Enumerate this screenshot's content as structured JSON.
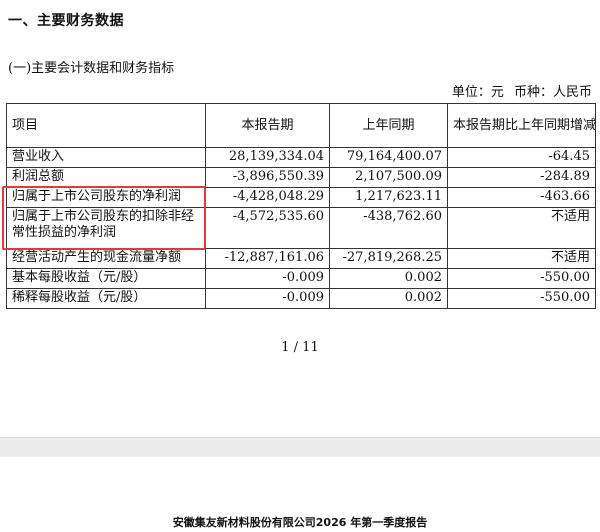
{
  "section_title": "一、主要财务数据",
  "subsection_title": "(一)主要会计数据和财务指标",
  "unit_line": {
    "unit": "单位：元",
    "currency": "币种：人民币"
  },
  "table": {
    "headers": [
      "项目",
      "本报告期",
      "上年同期",
      "本报告期比上年同期增减变动幅度(%)"
    ],
    "rows": [
      [
        "营业收入",
        "28,139,334.04",
        "79,164,400.07",
        "-64.45"
      ],
      [
        "利润总额",
        "-3,896,550.39",
        "2,107,500.09",
        "-284.89"
      ],
      [
        "归属于上市公司股东的净利润",
        "-4,428,048.29",
        "1,217,623.11",
        "-463.66"
      ],
      [
        "归属于上市公司股东的扣除非经常性损益的净利润",
        "-4,572,535.60",
        "-438,762.60",
        "不适用"
      ],
      [
        "经营活动产生的现金流量净额",
        "-12,887,161.06",
        "-27,819,268.25",
        "不适用"
      ],
      [
        "基本每股收益（元/股）",
        "-0.009",
        "0.002",
        "-550.00"
      ],
      [
        "稀释每股收益（元/股）",
        "-0.009",
        "0.002",
        "-550.00"
      ]
    ]
  },
  "highlight_color": "#e03b3b",
  "page_indicator": "1 / 11",
  "footer_text": "安徽集友新材料股份有限公司2026 年第一季度报告"
}
